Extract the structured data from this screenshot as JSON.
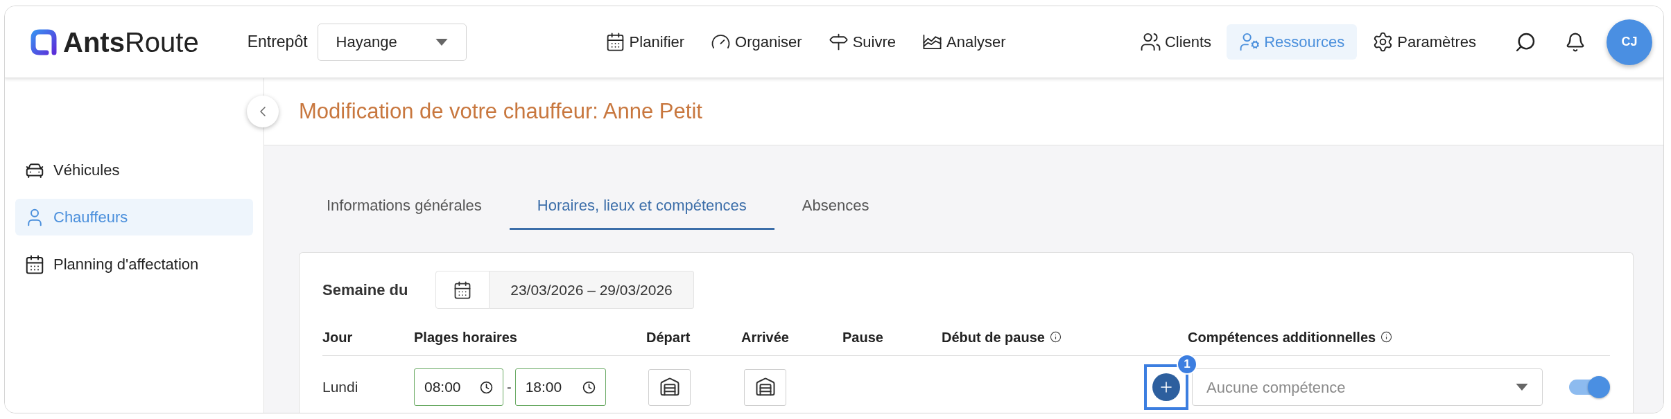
{
  "header": {
    "logo": "**Ants**Route",
    "warehouse": {
      "label": "Entrepôt",
      "value": "Hayange"
    },
    "main_nav": [
      {
        "label": "Planifier",
        "selected": false
      },
      {
        "label": "Organiser",
        "selected": false
      },
      {
        "label": "Suivre",
        "selected": false
      },
      {
        "label": "Analyser",
        "selected": false
      }
    ],
    "resource_nav": [
      {
        "label": "Clients",
        "selected": false
      },
      {
        "label": "Ressources",
        "selected": true
      },
      {
        "label": "Paramètres",
        "selected": false
      }
    ],
    "avatar": "CJ"
  },
  "sidebar": {
    "items": [
      {
        "label": "Véhicules",
        "selected": false
      },
      {
        "label": "Chauffeurs",
        "selected": true
      },
      {
        "label": "Planning d'affectation",
        "selected": false
      }
    ]
  },
  "page_title": "Modification de votre chauffeur: Anne Petit",
  "tabs": [
    {
      "label": "Informations générales",
      "selected": false
    },
    {
      "label": "Horaires, lieux et compétences",
      "selected": true
    },
    {
      "label": "Absences",
      "selected": false
    }
  ],
  "week": {
    "label": "Semaine du",
    "range": "23/03/2026 – 29/03/2026"
  },
  "table": {
    "columns": [
      {
        "label": "Jour",
        "info": false
      },
      {
        "label": "Plages horaires",
        "info": false
      },
      {
        "label": "Départ",
        "info": false
      },
      {
        "label": "Arrivée",
        "info": false
      },
      {
        "label": "Pause",
        "info": false
      },
      {
        "label": "Début de pause",
        "info": true
      },
      {
        "label": "Compétences additionnelles",
        "info": true
      }
    ],
    "rows": [
      {
        "day": "Lundi",
        "start": "08:00",
        "separator": "-",
        "end": "18:00",
        "skills_placeholder": "Aucune compétence",
        "enabled": true
      }
    ]
  },
  "annotation": {
    "badge": "1"
  }
}
